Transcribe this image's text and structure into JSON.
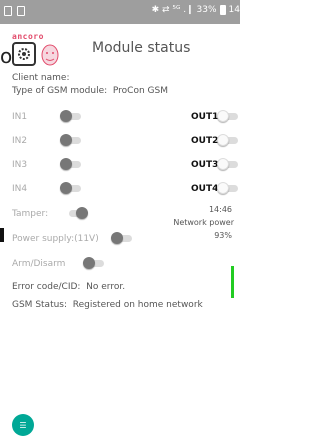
{
  "statusbar": {
    "right_text": "✱ ⇄ ⁵ᴳ .❙ 33%",
    "time": "14"
  },
  "brand": {
    "logo_text": "ancoro",
    "edge_glyph": "o",
    "left_mark": "l"
  },
  "header": {
    "title": "Module status"
  },
  "client": {
    "label": "Client name:",
    "value": ""
  },
  "gsm_type": {
    "label": "Type of GSM module:",
    "value": "ProCon GSM"
  },
  "inputs": [
    {
      "label": "IN1",
      "state": "off"
    },
    {
      "label": "IN2",
      "state": "off"
    },
    {
      "label": "IN3",
      "state": "off"
    },
    {
      "label": "IN4",
      "state": "off"
    }
  ],
  "outputs": [
    {
      "label": "OUT1",
      "state": "off"
    },
    {
      "label": "OUT2",
      "state": "off"
    },
    {
      "label": "OUT3",
      "state": "off"
    },
    {
      "label": "OUT4",
      "state": "off"
    }
  ],
  "tamper": {
    "label": "Tamper:",
    "state": "on"
  },
  "power_supply": {
    "label": "Power supply:(11V)",
    "state": "off"
  },
  "arm": {
    "label": "Arm/Disarm",
    "state": "off"
  },
  "clock": {
    "time": "14:46"
  },
  "network": {
    "label": "Network power",
    "value": "93%",
    "level": 0.93,
    "color": "#22cc22"
  },
  "error": {
    "label": "Error code/CID:",
    "value": "No error."
  },
  "gsm_status": {
    "label": "GSM Status:",
    "value": "Registered on home network"
  },
  "fab": {
    "icon": "sms-icon"
  },
  "colors": {
    "accent": "#00a896",
    "brand": "#e24b6b",
    "status_bar": "#9e9e9e"
  }
}
